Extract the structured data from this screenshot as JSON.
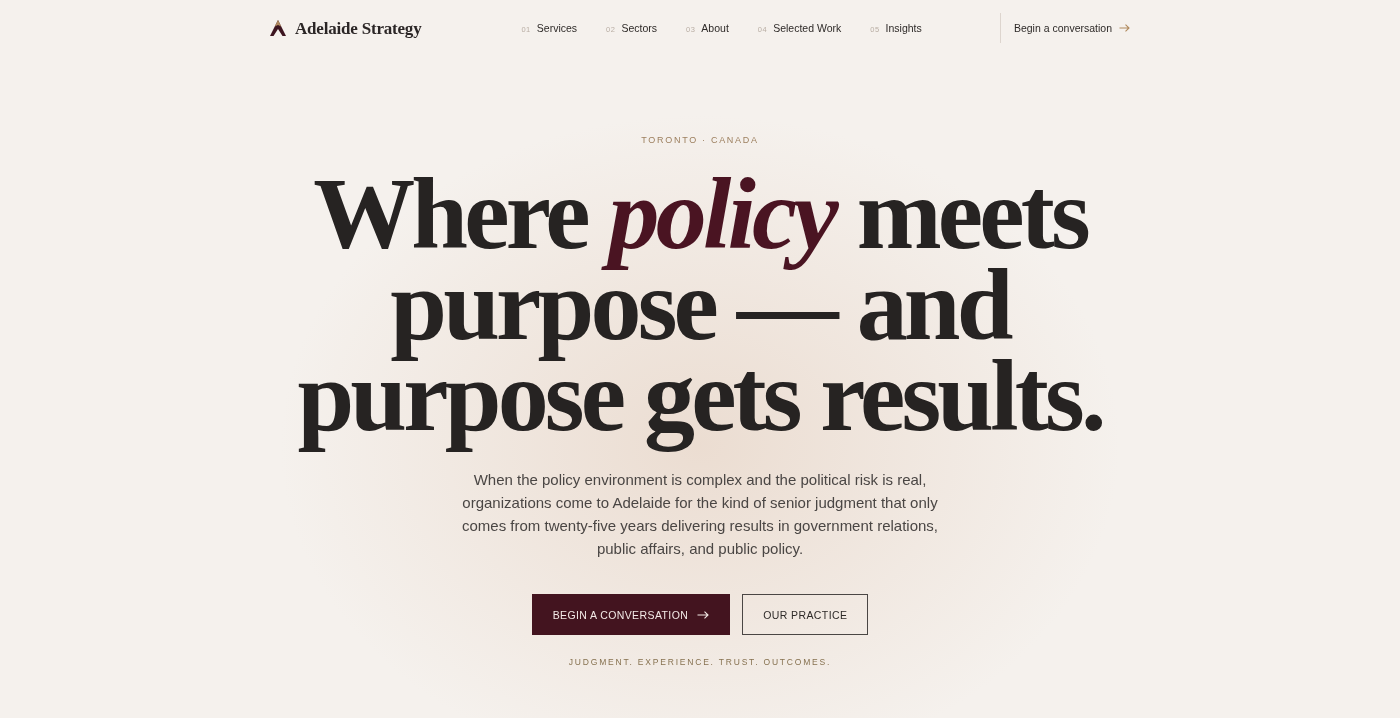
{
  "header": {
    "brand": "Adelaide Strategy",
    "nav": [
      {
        "number": "01",
        "label": "Services"
      },
      {
        "number": "02",
        "label": "Sectors"
      },
      {
        "number": "03",
        "label": "About"
      },
      {
        "number": "04",
        "label": "Selected Work"
      },
      {
        "number": "05",
        "label": "Insights"
      }
    ],
    "cta": "Begin a conversation"
  },
  "hero": {
    "eyebrow": "TORONTO · CANADA",
    "headline_lines": [
      "Where *policy* meets",
      "purpose — and",
      "purpose gets results."
    ],
    "lede": "When the policy environment is complex and the political risk is real, organizations come to Adelaide for the kind of senior judgment that only comes from twenty-five years delivering results in government relations, public affairs, and public policy.",
    "buttons": [
      {
        "label": "BEGIN A CONVERSATION",
        "kind": "primary"
      },
      {
        "label": "OUR PRACTICE",
        "kind": "secondary"
      }
    ],
    "tagline": "JUDGMENT. EXPERIENCE. TRUST. OUTCOMES."
  }
}
